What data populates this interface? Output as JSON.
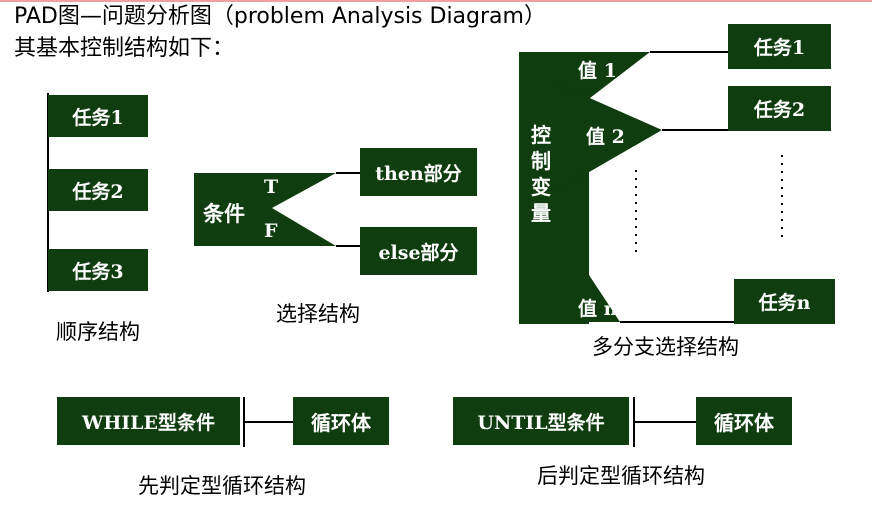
{
  "title_line1": "PAD图—问题分析图（problem Analysis Diagram）",
  "title_line2": "其基本控制结构如下：",
  "sequence": {
    "tasks": [
      "任务1",
      "任务2",
      "任务3"
    ],
    "caption": "顺序结构"
  },
  "selection": {
    "condition": "条件",
    "true_label": "T",
    "false_label": "F",
    "then_label": "then部分",
    "else_label": "else部分",
    "caption": "选择结构"
  },
  "multi": {
    "control_var": "控制变量",
    "value1": "值 1",
    "value2": "值 2",
    "valuen": "值 n",
    "task1": "任务1",
    "task2": "任务2",
    "taskn": "任务n",
    "caption": "多分支选择结构"
  },
  "while_loop": {
    "condition": "WHILE型条件",
    "body": "循环体",
    "caption": "先判定型循环结构"
  },
  "until_loop": {
    "condition": "UNTIL型条件",
    "body": "循环体",
    "caption": "后判定型循环结构"
  },
  "colors": {
    "box": "#0f3d0f",
    "text_on_box": "#ffffff",
    "line": "#000000"
  }
}
